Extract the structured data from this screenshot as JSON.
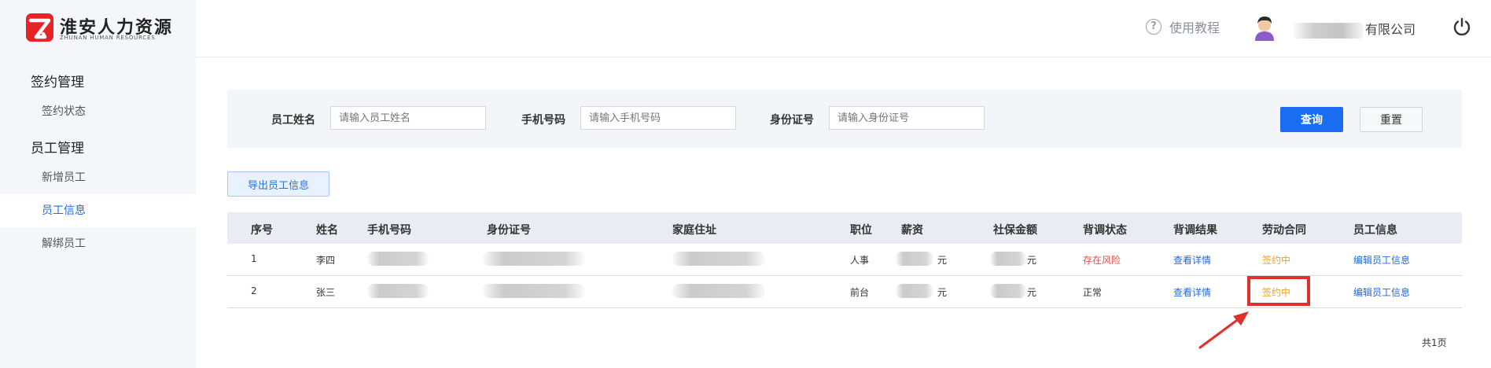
{
  "brand": {
    "title": "淮安人力资源",
    "subtitle": "ZHUNAN HUMAN RESOURCES",
    "red": "#e52525"
  },
  "sidebar": {
    "groups": [
      {
        "label": "签约管理",
        "items": [
          {
            "label": "签约状态"
          }
        ]
      },
      {
        "label": "员工管理",
        "items": [
          {
            "label": "新增员工"
          },
          {
            "label": "员工信息"
          },
          {
            "label": "解绑员工"
          }
        ]
      }
    ],
    "active_item": "员工信息"
  },
  "header": {
    "help_label": "使用教程",
    "help_icon": "question-circle-icon",
    "company_visible": "有限公司",
    "power_icon": "power-icon"
  },
  "search": {
    "name_label": "员工姓名",
    "name_placeholder": "请输入员工姓名",
    "phone_label": "手机号码",
    "phone_placeholder": "请输入手机号码",
    "id_label": "身份证号",
    "id_placeholder": "请输入身份证号",
    "query_label": "查询",
    "reset_label": "重置"
  },
  "export_label": "导出员工信息",
  "table": {
    "columns": [
      "序号",
      "姓名",
      "手机号码",
      "身份证号",
      "家庭住址",
      "职位",
      "薪资",
      "社保金额",
      "背调状态",
      "背调结果",
      "劳动合同",
      "员工信息"
    ],
    "rows": [
      {
        "index": "1",
        "name": "李四",
        "position": "人事",
        "salary_unit": "元",
        "social_unit": "元",
        "bg_status": "存在风险",
        "bg_result": "查看详情",
        "contract": "签约中",
        "action": "编辑员工信息"
      },
      {
        "index": "2",
        "name": "张三",
        "position": "前台",
        "salary_unit": "元",
        "social_unit": "元",
        "bg_status": "正常",
        "bg_result": "查看详情",
        "contract": "签约中",
        "action": "编辑员工信息"
      }
    ]
  },
  "pager_text": "共1页",
  "colors": {
    "primary": "#1a6cf0",
    "risk": "#e0504a",
    "signing": "#f0a020",
    "highlight": "#e0302a"
  }
}
